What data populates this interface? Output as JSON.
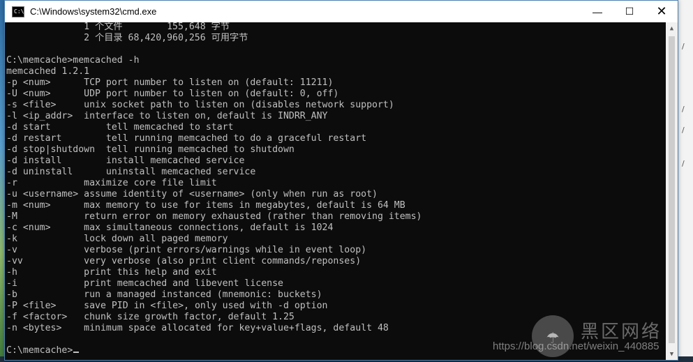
{
  "window": {
    "title": "C:\\Windows\\system32\\cmd.exe",
    "minimize_glyph": "—",
    "maximize_glyph": "☐",
    "close_glyph": "✕",
    "icon": "cmd-icon"
  },
  "console": {
    "lines": [
      "              1 个文件        155,648 字节",
      "              2 个目录 68,420,960,256 可用字节",
      "",
      "C:\\memcache>memcached -h",
      "memcached 1.2.1",
      "-p <num>      TCP port number to listen on (default: 11211)",
      "-U <num>      UDP port number to listen on (default: 0, off)",
      "-s <file>     unix socket path to listen on (disables network support)",
      "-l <ip_addr>  interface to listen on, default is INDRR_ANY",
      "-d start          tell memcached to start",
      "-d restart        tell running memcached to do a graceful restart",
      "-d stop|shutdown  tell running memcached to shutdown",
      "-d install        install memcached service",
      "-d uninstall      uninstall memcached service",
      "-r            maximize core file limit",
      "-u <username> assume identity of <username> (only when run as root)",
      "-m <num>      max memory to use for items in megabytes, default is 64 MB",
      "-M            return error on memory exhausted (rather than removing items)",
      "-c <num>      max simultaneous connections, default is 1024",
      "-k            lock down all paged memory",
      "-v            verbose (print errors/warnings while in event loop)",
      "-vv           very verbose (also print client commands/reponses)",
      "-h            print this help and exit",
      "-i            print memcached and libevent license",
      "-b            run a managed instanced (mnemonic: buckets)",
      "-P <file>     save PID in <file>, only used with -d option",
      "-f <factor>   chunk size growth factor, default 1.25",
      "-n <bytes>    minimum space allocated for key+value+flags, default 48",
      "",
      "C:\\memcache>"
    ]
  },
  "scrollbar": {
    "up_glyph": "▲",
    "down_glyph": "▼"
  },
  "watermark": {
    "url": "https://blog.csdn.net/weixin_440885",
    "brand": "黑区网络"
  },
  "background": {
    "right_peek": [
      "/",
      "/",
      "/",
      "/"
    ]
  },
  "colors": {
    "console_bg": "#0c0c0c",
    "console_fg": "#c0c0c0",
    "titlebar_bg": "#ffffff"
  }
}
